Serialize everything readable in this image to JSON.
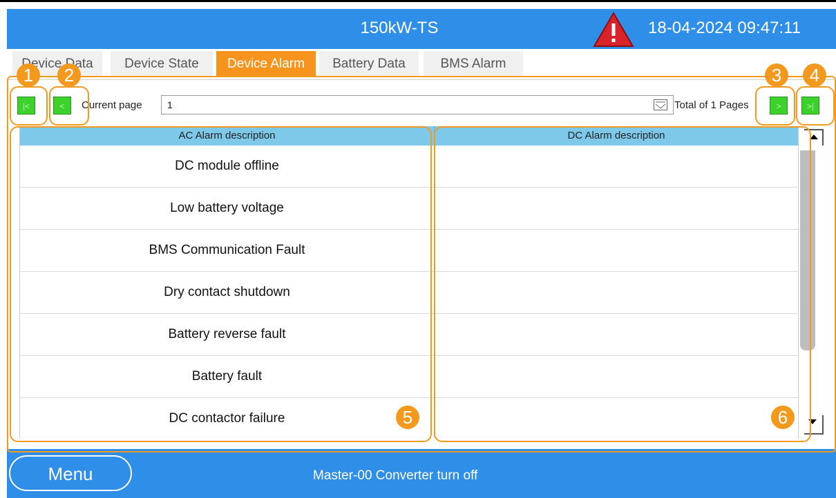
{
  "header": {
    "title": "150kW-TS",
    "datetime": "18-04-2024 09:47:11",
    "alert_icon": "warning-triangle-icon",
    "color": "#2e8ee8"
  },
  "tabs": [
    {
      "label": "Device Data",
      "active": false
    },
    {
      "label": "Device State",
      "active": false
    },
    {
      "label": "Device Alarm",
      "active": true
    },
    {
      "label": "Battery Data",
      "active": false
    },
    {
      "label": "BMS Alarm",
      "active": false
    }
  ],
  "pagination": {
    "first_label": "|<",
    "prev_label": "<",
    "next_label": ">",
    "last_label": ">|",
    "current_page_label": "Current page",
    "current_page_value": "1",
    "total_label": "Total of 1 Pages"
  },
  "table": {
    "ac_header": "AC Alarm description",
    "dc_header": "DC Alarm description",
    "rows": [
      {
        "ac": "DC module offline",
        "dc": ""
      },
      {
        "ac": "Low battery voltage",
        "dc": ""
      },
      {
        "ac": "BMS Communication Fault",
        "dc": ""
      },
      {
        "ac": "Dry contact shutdown",
        "dc": ""
      },
      {
        "ac": "Battery reverse fault",
        "dc": ""
      },
      {
        "ac": "Battery fault",
        "dc": ""
      },
      {
        "ac": "DC contactor failure",
        "dc": ""
      }
    ]
  },
  "footer": {
    "menu_label": "Menu",
    "status": "Master-00 Converter turn off"
  },
  "annotations": [
    "1",
    "2",
    "3",
    "4",
    "5",
    "6"
  ],
  "accent_color": "#f39a1e"
}
